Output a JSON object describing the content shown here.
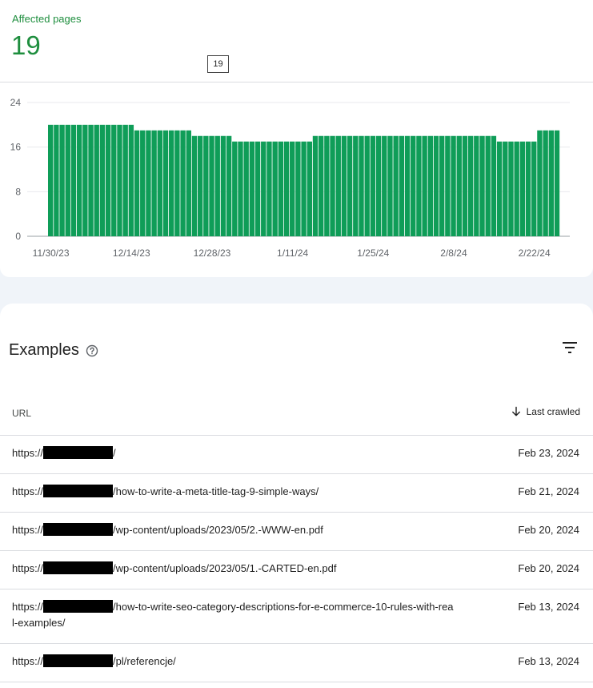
{
  "metric": {
    "label": "Affected pages",
    "value": "19",
    "tooltip": "19"
  },
  "chart_data": {
    "type": "bar",
    "color": "#0f9d58",
    "y_ticks": [
      "24",
      "16",
      "8",
      "0"
    ],
    "ylim": [
      0,
      24
    ],
    "x_tick_labels": [
      "11/30/23",
      "12/14/23",
      "12/28/23",
      "1/11/24",
      "1/25/24",
      "2/8/24",
      "2/22/24"
    ],
    "categories": [
      "11/30/23",
      "12/1/23",
      "12/2/23",
      "12/3/23",
      "12/4/23",
      "12/5/23",
      "12/6/23",
      "12/7/23",
      "12/8/23",
      "12/9/23",
      "12/10/23",
      "12/11/23",
      "12/12/23",
      "12/13/23",
      "12/14/23",
      "12/15/23",
      "12/16/23",
      "12/17/23",
      "12/18/23",
      "12/19/23",
      "12/20/23",
      "12/21/23",
      "12/22/23",
      "12/23/23",
      "12/24/23",
      "12/25/23",
      "12/26/23",
      "12/27/23",
      "12/28/23",
      "12/29/23",
      "12/30/23",
      "12/31/23",
      "1/1/24",
      "1/2/24",
      "1/3/24",
      "1/4/24",
      "1/5/24",
      "1/6/24",
      "1/7/24",
      "1/8/24",
      "1/9/24",
      "1/10/24",
      "1/11/24",
      "1/12/24",
      "1/13/24",
      "1/14/24",
      "1/15/24",
      "1/16/24",
      "1/17/24",
      "1/18/24",
      "1/19/24",
      "1/20/24",
      "1/21/24",
      "1/22/24",
      "1/23/24",
      "1/24/24",
      "1/25/24",
      "1/26/24",
      "1/27/24",
      "1/28/24",
      "1/29/24",
      "1/30/24",
      "1/31/24",
      "2/1/24",
      "2/2/24",
      "2/3/24",
      "2/4/24",
      "2/5/24",
      "2/6/24",
      "2/7/24",
      "2/8/24",
      "2/9/24",
      "2/10/24",
      "2/11/24",
      "2/12/24",
      "2/13/24",
      "2/14/24",
      "2/15/24",
      "2/16/24",
      "2/17/24",
      "2/18/24",
      "2/19/24",
      "2/20/24",
      "2/21/24",
      "2/22/24",
      "2/23/24",
      "2/24/24"
    ],
    "values": [
      20,
      20,
      20,
      20,
      20,
      20,
      20,
      20,
      20,
      20,
      20,
      20,
      20,
      20,
      20,
      19,
      19,
      19,
      19,
      19,
      19,
      19,
      19,
      19,
      19,
      18,
      18,
      18,
      18,
      18,
      18,
      18,
      17,
      17,
      17,
      17,
      17,
      17,
      17,
      17,
      17,
      17,
      17,
      17,
      17,
      17,
      18,
      18,
      18,
      18,
      18,
      18,
      18,
      18,
      18,
      18,
      18,
      18,
      18,
      18,
      18,
      18,
      18,
      18,
      18,
      18,
      18,
      18,
      18,
      18,
      18,
      18,
      18,
      18,
      18,
      18,
      18,
      18,
      17,
      17,
      17,
      17,
      17,
      17,
      17,
      19,
      19,
      19,
      19
    ]
  },
  "examples": {
    "title": "Examples",
    "help_icon": "help-circle-icon",
    "filter_icon": "filter-icon",
    "columns": {
      "url": "URL",
      "last_crawled": "Last crawled"
    },
    "rows": [
      {
        "prefix": "https://",
        "path": "/",
        "date": "Feb 23, 2024"
      },
      {
        "prefix": "https://",
        "path": "/how-to-write-a-meta-title-tag-9-simple-ways/",
        "date": "Feb 21, 2024"
      },
      {
        "prefix": "https://",
        "path": "/wp-content/uploads/2023/05/2.-WWW-en.pdf",
        "date": "Feb 20, 2024"
      },
      {
        "prefix": "https://",
        "path": "/wp-content/uploads/2023/05/1.-CARTED-en.pdf",
        "date": "Feb 20, 2024"
      },
      {
        "prefix": "https://",
        "path": "/how-to-write-seo-category-descriptions-for-e-commerce-10-rules-with-rea",
        "path_line2": "l-examples/",
        "date": "Feb 13, 2024"
      },
      {
        "prefix": "https://",
        "path": "/pl/referencje/",
        "date": "Feb 13, 2024"
      }
    ]
  }
}
